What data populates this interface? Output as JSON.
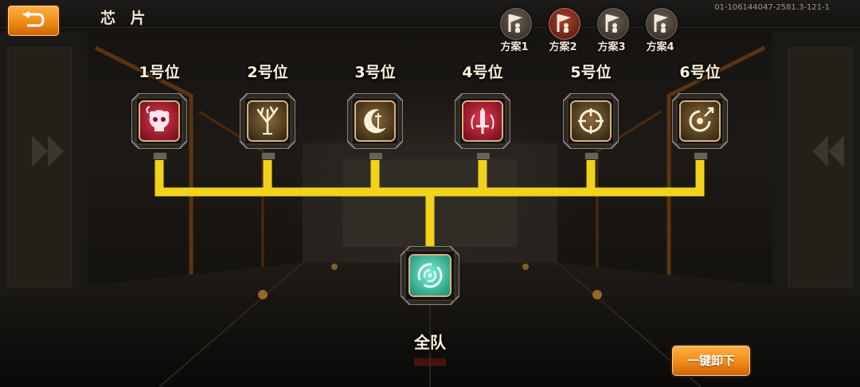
{
  "header": {
    "title": "芯 片",
    "build_id": "01-106144047-2581.3-121-1"
  },
  "colors": {
    "accent_orange": "#f08a16",
    "connector_yellow": "#f2d21a",
    "red_chip": "#b5162a",
    "gold_chip": "#c9942a",
    "teal_chip": "#3fd6b4"
  },
  "presets": [
    {
      "label": "方案1",
      "active": false,
      "icon": "flag-person-icon"
    },
    {
      "label": "方案2",
      "active": true,
      "icon": "flag-person-icon"
    },
    {
      "label": "方案3",
      "active": false,
      "icon": "flag-person-icon"
    },
    {
      "label": "方案4",
      "active": false,
      "icon": "flag-person-icon"
    }
  ],
  "slots": [
    {
      "label": "1号位",
      "chip_color": "red",
      "icon": "horned-skull-icon"
    },
    {
      "label": "2号位",
      "chip_color": "gold",
      "icon": "withered-tree-icon"
    },
    {
      "label": "3号位",
      "chip_color": "gold",
      "icon": "crescent-moon-icon"
    },
    {
      "label": "4号位",
      "chip_color": "red",
      "icon": "flaming-sword-icon"
    },
    {
      "label": "5号位",
      "chip_color": "gold",
      "icon": "crosshair-icon"
    },
    {
      "label": "6号位",
      "chip_color": "gold",
      "icon": "swirl-arrow-icon"
    }
  ],
  "team_chip": {
    "label": "全队",
    "chip_color": "teal",
    "icon": "vortex-icon"
  },
  "buttons": {
    "unequip_all": "一键卸下",
    "back": "back-arrow-icon"
  }
}
